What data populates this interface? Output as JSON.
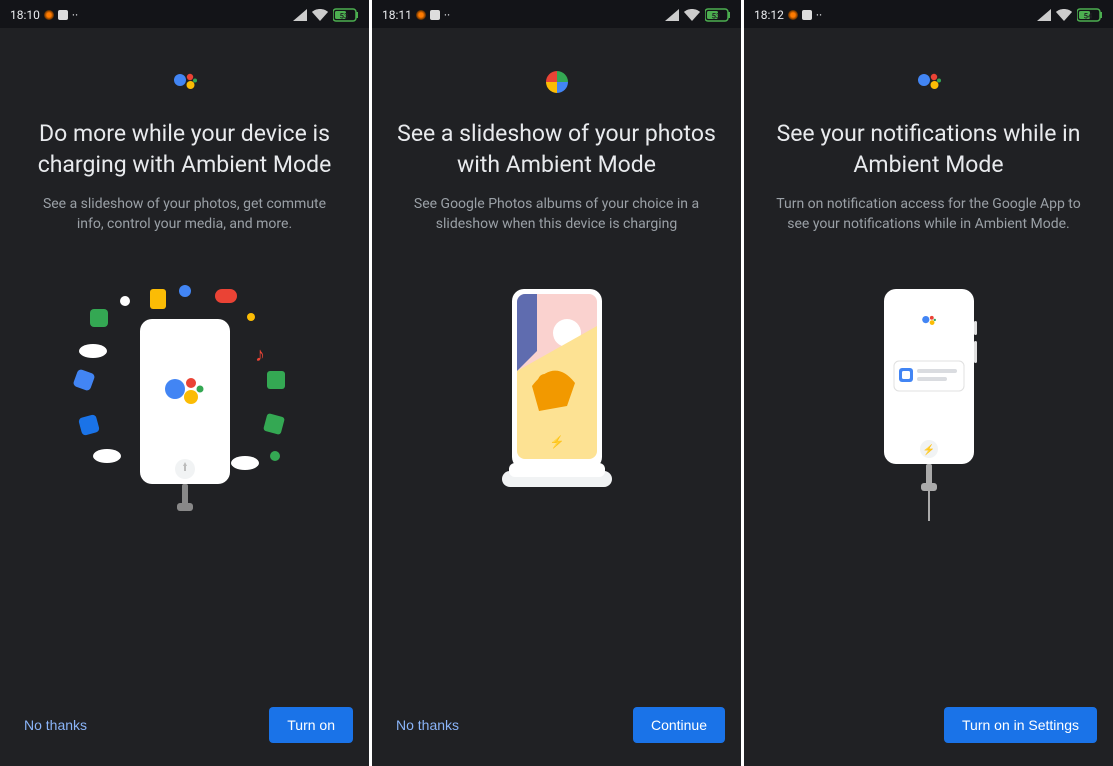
{
  "screens": [
    {
      "status": {
        "time": "18:10",
        "battery": "53"
      },
      "icon": "assistant-icon",
      "title": "Do more while your device is charging with Ambient Mode",
      "subtitle": "See a slideshow of your photos, get commute info, control your media, and more.",
      "secondary_label": "No thanks",
      "primary_label": "Turn on"
    },
    {
      "status": {
        "time": "18:11",
        "battery": "53"
      },
      "icon": "photos-icon",
      "title": "See a slideshow of your photos with Ambient Mode",
      "subtitle": "See Google Photos albums of your choice in a slideshow when this device is charging",
      "secondary_label": "No thanks",
      "primary_label": "Continue"
    },
    {
      "status": {
        "time": "18:12",
        "battery": "54"
      },
      "icon": "assistant-icon",
      "title": "See your notifications while in Ambient Mode",
      "subtitle": "Turn on notification access for the Google App to see your notifications while in Ambient Mode.",
      "secondary_label": "",
      "primary_label": "Turn on in Settings"
    }
  ]
}
